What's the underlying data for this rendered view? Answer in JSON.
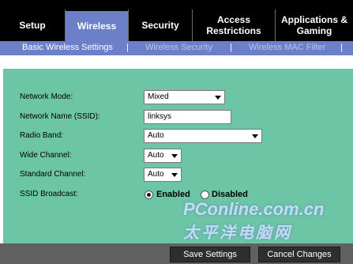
{
  "nav": {
    "tabs": [
      {
        "label": "Setup"
      },
      {
        "label": "Wireless"
      },
      {
        "label": "Security"
      },
      {
        "label": "Access\nRestrictions"
      },
      {
        "label": "Applications &\nGaming"
      }
    ]
  },
  "subnav": {
    "items": [
      {
        "label": "Basic Wireless Settings"
      },
      {
        "label": "Wireless Security"
      },
      {
        "label": "Wireless MAC Filter"
      }
    ],
    "separator": "|"
  },
  "form": {
    "network_mode": {
      "label": "Network Mode:",
      "value": "Mixed"
    },
    "ssid": {
      "label": "Network Name (SSID):",
      "value": "linksys"
    },
    "radio_band": {
      "label": "Radio Band:",
      "value": "Auto"
    },
    "wide_channel": {
      "label": "Wide Channel:",
      "value": "Auto"
    },
    "standard_channel": {
      "label": "Standard Channel:",
      "value": "Auto"
    },
    "ssid_broadcast": {
      "label": "SSID Broadcast:",
      "enabled_label": "Enabled",
      "disabled_label": "Disabled",
      "selected": "Enabled"
    }
  },
  "buttons": {
    "save": "Save Settings",
    "cancel": "Cancel Changes"
  },
  "watermark": {
    "line1": "PConline.com.cn",
    "line2": "太平洋电脑网"
  }
}
